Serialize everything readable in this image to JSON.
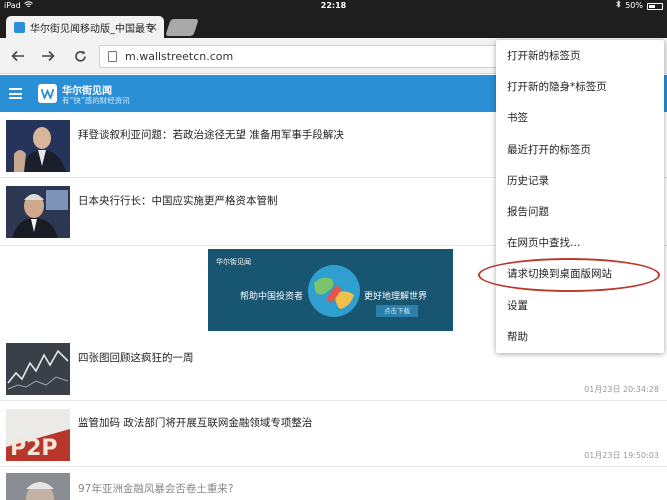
{
  "status_bar": {
    "device": "iPad",
    "time": "22:18",
    "battery_text": "50%",
    "battery_level": 0.5
  },
  "tab": {
    "title": "华尔街见闻移动版_中国最专"
  },
  "toolbar": {
    "url": "m.wallstreetcn.com"
  },
  "site": {
    "name": "华尔街见闻",
    "slogan": "有“快”感的财经资讯"
  },
  "feed": {
    "items": [
      {
        "title": "拜登谈叙利亚问题：若政治途径无望 准备用军事手段解决",
        "time": ""
      },
      {
        "title": "日本央行行长：中国应实施更严格资本管制",
        "time": ""
      },
      {
        "title": "四张图回顾这疯狂的一周",
        "time": "01月23日 20:34:28"
      },
      {
        "title": "监管加码 政法部门将开展互联网金融领域专项整治",
        "time": "01月23日 19:50:03"
      },
      {
        "title": "97年亚洲金融风暴会否卷土重来?",
        "time": ""
      }
    ]
  },
  "banner": {
    "brand": "华尔街见闻",
    "left_text": "帮助中国投资者",
    "right_text": "更好地理解世界",
    "button": "点击下载"
  },
  "menu": {
    "items": [
      "打开新的标签页",
      "打开新的隐身*标签页",
      "书签",
      "最近打开的标签页",
      "历史记录",
      "报告问题",
      "在网页中查找…",
      "请求切换到桌面版网站",
      "设置",
      "帮助"
    ]
  },
  "colors": {
    "site_header": "#2b8fd6",
    "highlight_ring": "#b83a2c",
    "banner_bg": "#175570"
  }
}
